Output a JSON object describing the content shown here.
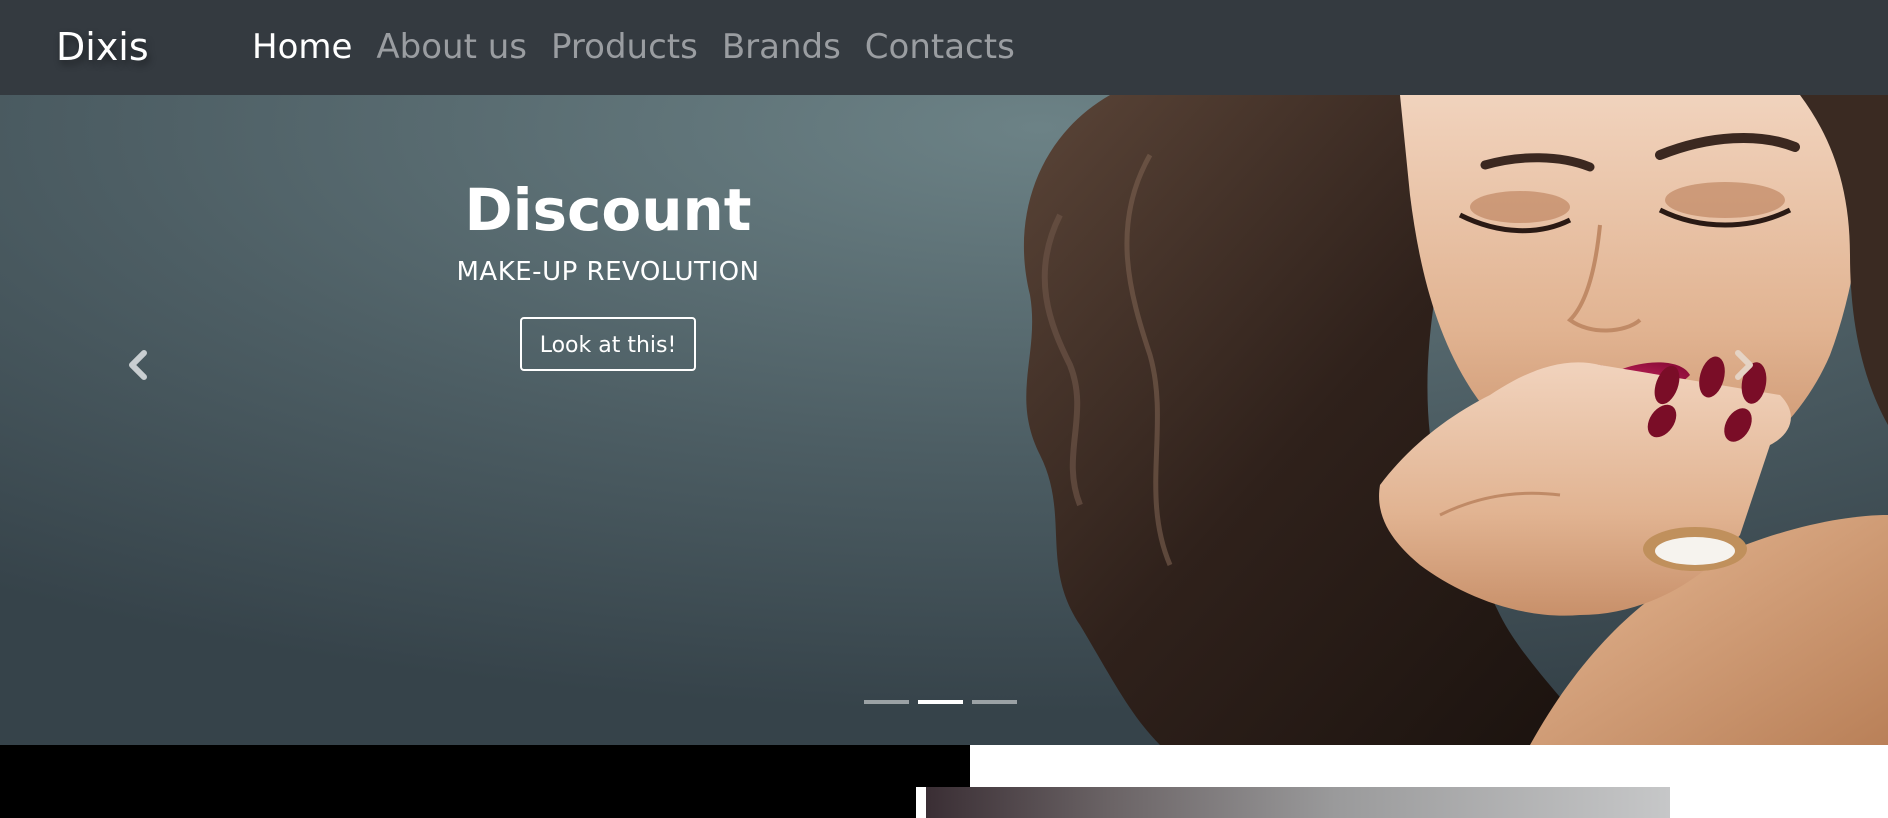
{
  "navbar": {
    "brand": "Dixis",
    "links": [
      {
        "label": "Home",
        "active": true
      },
      {
        "label": "About us",
        "active": false
      },
      {
        "label": "Products",
        "active": false
      },
      {
        "label": "Brands",
        "active": false
      },
      {
        "label": "Contacts",
        "active": false
      }
    ]
  },
  "carousel": {
    "title": "Discount",
    "subtitle": "MAKE-UP REVOLUTION",
    "button_label": "Look at this!",
    "prev_icon": "chevron-left-icon",
    "next_icon": "chevron-right-icon",
    "indicators_count": 3,
    "active_indicator": 2
  },
  "colors": {
    "navbar_bg": "#343a40",
    "nav_inactive": "#9a9da1",
    "nav_active": "#ffffff",
    "slide_bg": "#4f6167",
    "lips": "#b0134a"
  }
}
